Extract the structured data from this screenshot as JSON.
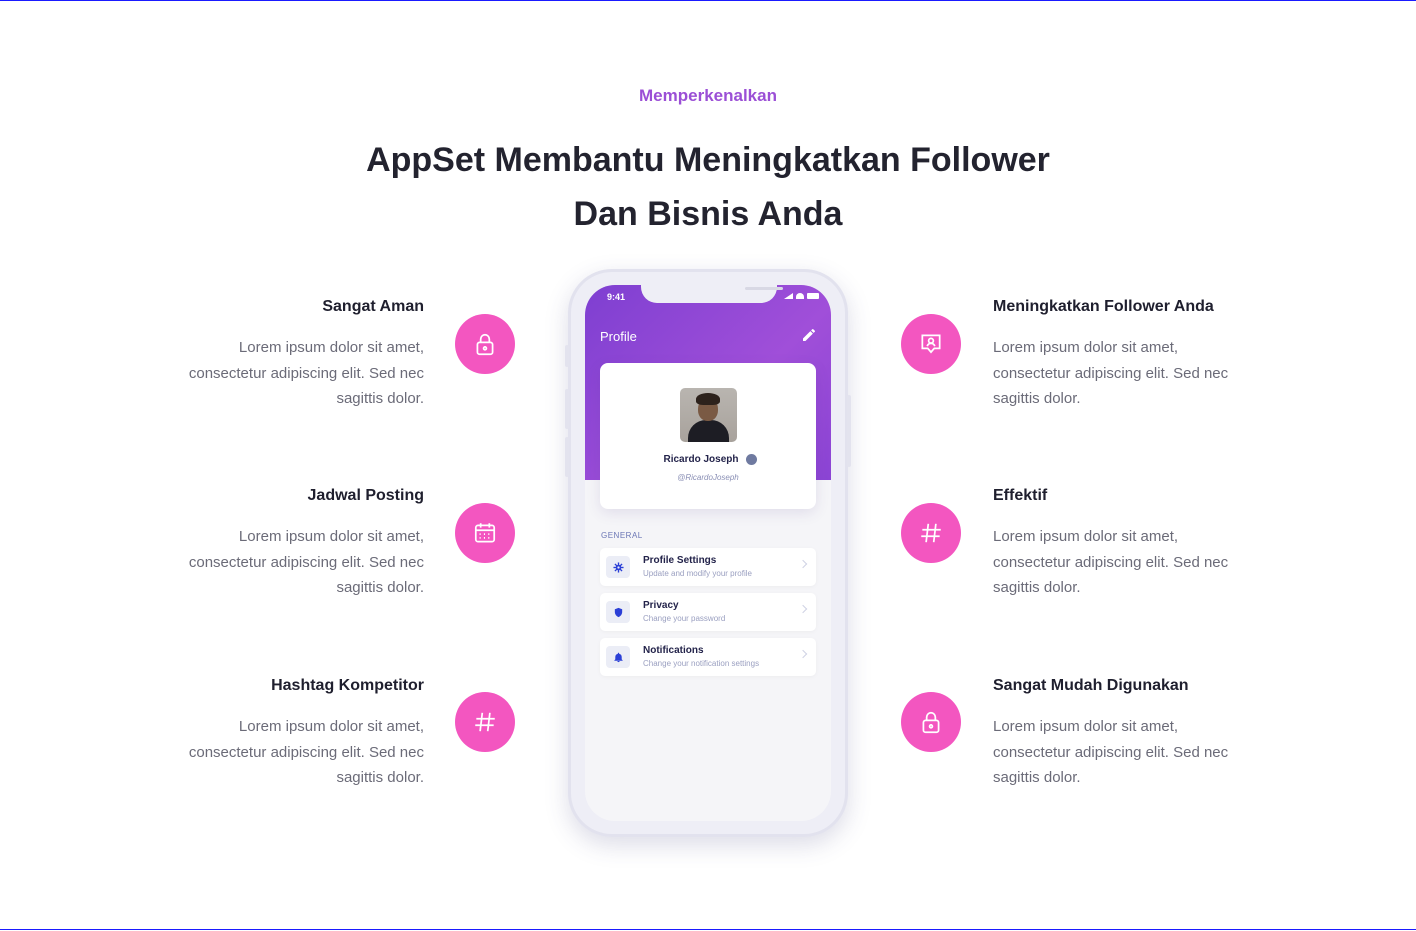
{
  "section": {
    "eyebrow": "Memperkenalkan",
    "headline_line1": "AppSet Membantu Meningkatkan Follower",
    "headline_line2": "Dan Bisnis Anda"
  },
  "features_left": [
    {
      "title": "Sangat Aman",
      "line1": "Lorem ipsum dolor sit amet,",
      "line2": "consectetur adipiscing elit. Sed nec",
      "line3": "sagittis dolor.",
      "icon": "lock-icon"
    },
    {
      "title": "Jadwal Posting",
      "line1": "Lorem ipsum dolor sit amet,",
      "line2": "consectetur adipiscing elit. Sed nec",
      "line3": "sagittis dolor.",
      "icon": "calendar-icon"
    },
    {
      "title": "Hashtag Kompetitor",
      "line1": "Lorem ipsum dolor sit amet,",
      "line2": "consectetur adipiscing elit. Sed nec",
      "line3": "sagittis dolor.",
      "icon": "hashtag-icon"
    }
  ],
  "features_right": [
    {
      "title": "Meningkatkan Follower Anda",
      "line1": "Lorem ipsum dolor sit amet,",
      "line2": "consectetur adipiscing elit. Sed nec",
      "line3": "sagittis dolor.",
      "icon": "user-message-icon"
    },
    {
      "title": "Effektif",
      "line1": "Lorem ipsum dolor sit amet,",
      "line2": "consectetur adipiscing elit. Sed nec",
      "line3": "sagittis dolor.",
      "icon": "hashtag-icon"
    },
    {
      "title": "Sangat Mudah Digunakan",
      "line1": "Lorem ipsum dolor sit amet,",
      "line2": "consectetur adipiscing elit. Sed nec",
      "line3": "sagittis dolor.",
      "icon": "lock-icon"
    }
  ],
  "phone": {
    "time": "9:41",
    "screen_title": "Profile",
    "user_name": "Ricardo Joseph",
    "user_handle": "@RicardoJoseph",
    "section_label": "GENERAL",
    "menu": [
      {
        "title": "Profile Settings",
        "subtitle": "Update and modify your profile",
        "icon": "gear-icon"
      },
      {
        "title": "Privacy",
        "subtitle": "Change your password",
        "icon": "shield-icon"
      },
      {
        "title": "Notifications",
        "subtitle": "Change your notification settings",
        "icon": "bell-icon"
      }
    ]
  },
  "colors": {
    "accent_pink": "#f356c0",
    "eyebrow_purple": "#9b4fd6",
    "phone_header_gradient": "#8b44d4"
  }
}
